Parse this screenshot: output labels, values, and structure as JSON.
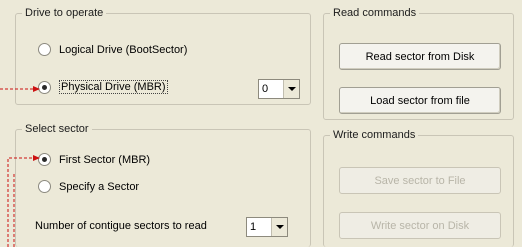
{
  "drive_group": {
    "legend": "Drive to operate",
    "logical_label": "Logical Drive (BootSector)",
    "physical_label": "Physical Drive (MBR)",
    "physical_selected": true,
    "drive_number": "0"
  },
  "sector_group": {
    "legend": "Select sector",
    "first_label": "First Sector (MBR)",
    "specify_label": "Specify a Sector",
    "first_selected": true,
    "count_label": "Number of contigue sectors to read",
    "count_value": "1"
  },
  "read_group": {
    "legend": "Read commands",
    "read_disk_label": "Read sector from Disk",
    "load_file_label": "Load sector from file"
  },
  "write_group": {
    "legend": "Write commands",
    "save_file_label": "Save sector to File",
    "write_disk_label": "Write sector on Disk",
    "buttons_enabled": false
  },
  "annotation_color": "#cc1111"
}
